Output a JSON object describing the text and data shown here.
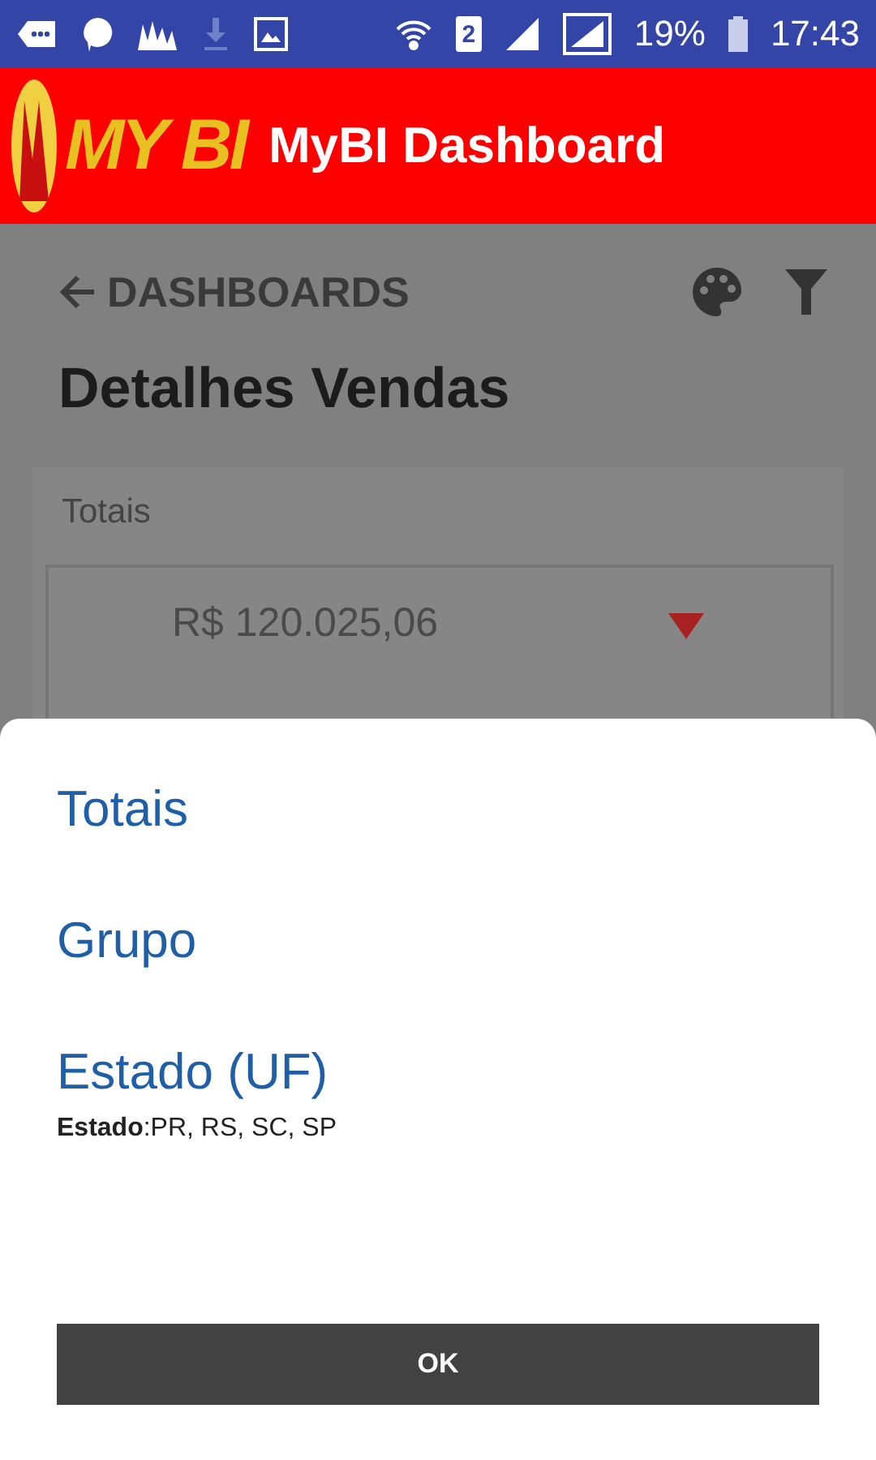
{
  "status_bar": {
    "sim": "2",
    "battery": "19%",
    "time": "17:43"
  },
  "app_bar": {
    "logo": "MY BI",
    "title": "MyBI Dashboard"
  },
  "nav": {
    "back": "DASHBOARDS"
  },
  "page_title": "Detalhes Vendas",
  "card": {
    "title": "Totais",
    "value": "R$ 120.025,06",
    "declining": true
  },
  "sheet": {
    "items": [
      {
        "label": "Totais"
      },
      {
        "label": "Grupo"
      },
      {
        "label": "Estado (UF)",
        "detail": "**Estado**:PR, RS, SC, SP"
      }
    ],
    "button": "OK"
  }
}
